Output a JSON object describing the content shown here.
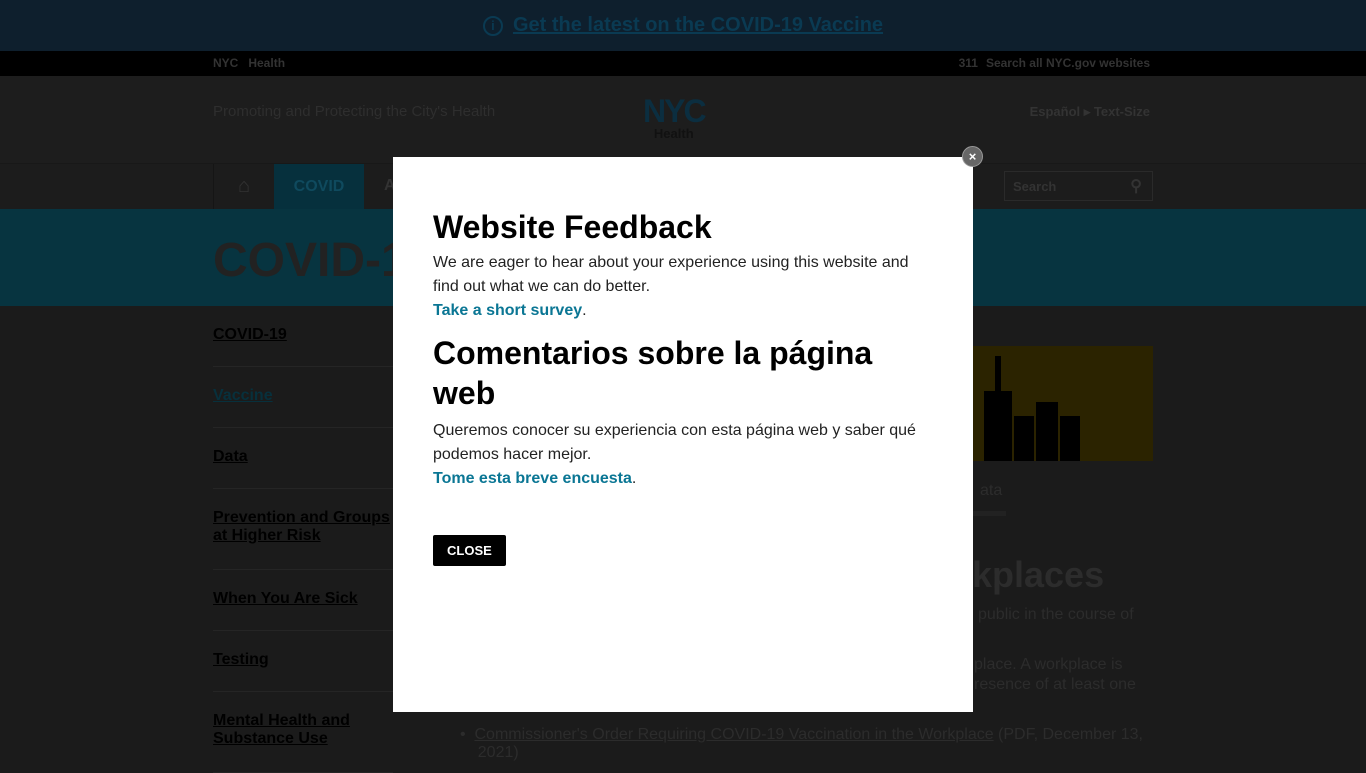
{
  "banner": {
    "icon": "info-icon",
    "text": "Get the latest on the COVID-19 Vaccine"
  },
  "topbar": {
    "nyc": "NYC",
    "health": "Health",
    "n311": "311",
    "search_all": "Search all NYC.gov websites"
  },
  "header": {
    "tagline": "Promoting and Protecting the City's Health",
    "logo_big": "NYC",
    "logo_small": "Health",
    "espanol": "Español",
    "text_size": "Text-Size"
  },
  "nav": {
    "home_icon": "home-icon",
    "covid": "COVID",
    "next": "A",
    "search_placeholder": "Search",
    "search_icon": "search-icon"
  },
  "hero": {
    "title": "COVID-1"
  },
  "sidebar": {
    "items": [
      {
        "label": "COVID-19"
      },
      {
        "label": "Vaccine"
      },
      {
        "label": "Data"
      },
      {
        "label": "Prevention and Groups at Higher Risk"
      },
      {
        "label": "When You Are Sick"
      },
      {
        "label": "Testing"
      },
      {
        "label": "Mental Health and Substance Use"
      }
    ]
  },
  "content": {
    "data_link": "ata",
    "heading": "kplaces",
    "p1": "public in the course of",
    "p2a": "place. A workplace is",
    "p2b": "resence of at least one",
    "list_link": "Commissioner's Order Requiring COVID-19 Vaccination in the Workplace",
    "list_meta": " (PDF, December 13,",
    "list_meta2": "2021)"
  },
  "modal": {
    "title_en": "Website Feedback",
    "body_en": "We are eager to hear about your experience using this website and find out what we can do better.",
    "link_en": "Take a short survey",
    "title_es": "Comentarios sobre la página web",
    "body_es": "Queremos conocer su experiencia con esta página web y saber qué podemos hacer mejor.",
    "link_es": "Tome esta breve encuesta",
    "period": ".",
    "close": "CLOSE",
    "close_x": "×"
  },
  "colors": {
    "link": "#0a7694",
    "button": "#000000"
  }
}
